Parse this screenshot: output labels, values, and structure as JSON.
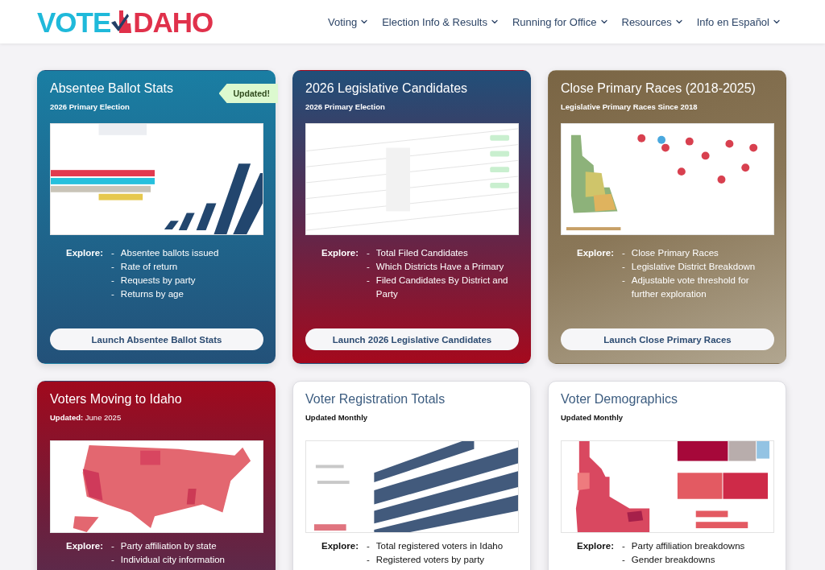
{
  "header": {
    "logo": {
      "left": "VOTE",
      "right": "DAHO"
    },
    "nav": [
      {
        "label": "Voting"
      },
      {
        "label": "Election Info & Results"
      },
      {
        "label": "Running for Office"
      },
      {
        "label": "Resources"
      },
      {
        "label": "Info en Español"
      }
    ]
  },
  "cards": [
    {
      "title": "Absentee Ballot Stats",
      "subtitle": "2026 Primary Election",
      "badge": "Updated!",
      "explore": {
        "label": "Explore:",
        "bullet": "-",
        "items": [
          "Absentee ballots issued",
          "Rate of return",
          "Requests by party",
          "Returns by age"
        ]
      },
      "button": "Launch Absentee Ballot Stats"
    },
    {
      "title": "2026 Legislative Candidates",
      "subtitle": "2026 Primary Election",
      "explore": {
        "label": "Explore:",
        "bullet": "-",
        "items": [
          "Total Filed Candidates",
          "Which Districts Have a Primary",
          "Filed Candidates By District and Party"
        ]
      },
      "button": "Launch 2026 Legislative Candidates"
    },
    {
      "title": "Close Primary Races (2018-2025)",
      "subtitle": "Legislative Primary Races Since 2018",
      "explore": {
        "label": "Explore:",
        "bullet": "-",
        "items": [
          "Close Primary Races",
          "Legislative District Breakdown",
          "Adjustable vote threshold for further exploration"
        ]
      },
      "button": "Launch Close Primary Races"
    },
    {
      "title": "Voters Moving to Idaho",
      "subtitle": "**Updated:** June 2025",
      "explore": {
        "label": "Explore:",
        "bullet": "-",
        "items": [
          "Party affiliation by state",
          "Individual city information"
        ]
      }
    },
    {
      "title": "Voter Registration Totals",
      "subtitle": "Updated Monthly",
      "explore": {
        "label": "Explore:",
        "bullet": "-",
        "items": [
          "Total registered voters in Idaho",
          "Registered voters by party"
        ]
      }
    },
    {
      "title": "Voter Demographics",
      "subtitle": "Updated Monthly",
      "explore": {
        "label": "Explore:",
        "bullet": "-",
        "items": [
          "Party affiliation breakdowns",
          "Gender breakdowns"
        ]
      }
    }
  ]
}
